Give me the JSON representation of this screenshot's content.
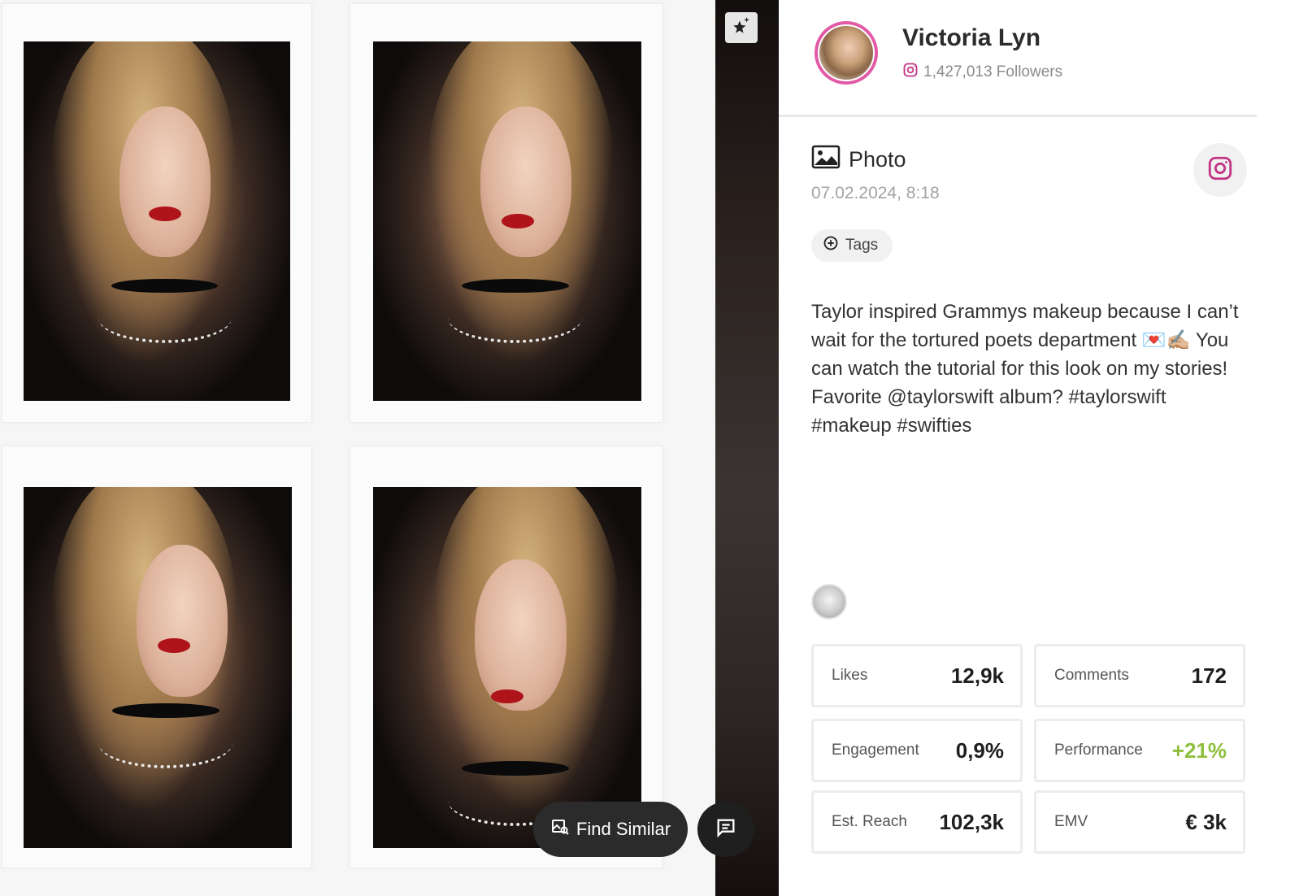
{
  "profile": {
    "name": "Victoria Lyn",
    "followers": "1,427,013 Followers"
  },
  "post": {
    "type": "Photo",
    "date": "07.02.2024, 8:18",
    "tags_label": "Tags",
    "caption": "Taylor inspired Grammys makeup because I can’t wait for the tortured poets department 💌✍🏼 You can watch the tutorial for this look on my stories! Favorite @taylorswift album? #taylorswift #makeup #swifties"
  },
  "actions": {
    "find_similar": "Find Similar"
  },
  "stats": [
    {
      "label": "Likes",
      "value": "12,9k"
    },
    {
      "label": "Comments",
      "value": "172"
    },
    {
      "label": "Engagement",
      "value": "0,9%"
    },
    {
      "label": "Performance",
      "value": "+21%"
    },
    {
      "label": "Est. Reach",
      "value": "102,3k"
    },
    {
      "label": "EMV",
      "value": "€ 3k"
    }
  ],
  "icons": {
    "platform": "instagram-icon",
    "favorite": "star-sparkle-icon",
    "find_similar": "image-search-icon",
    "comment": "comment-icon",
    "post_type": "image-icon",
    "tags": "plus-circle-icon"
  },
  "colors": {
    "instagram": "#c13584",
    "performance_positive": "#8fbf3e",
    "dark_button": "#2b2b2b"
  }
}
